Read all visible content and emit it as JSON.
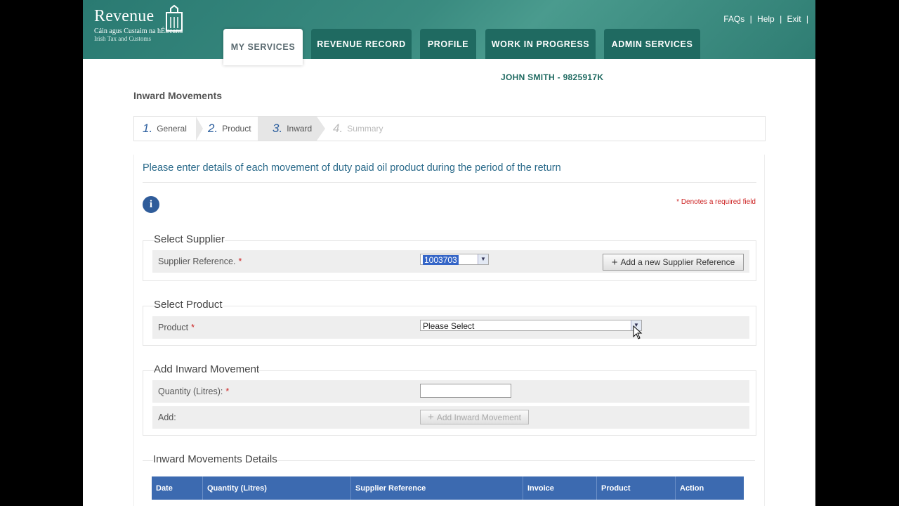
{
  "header": {
    "brand": "Revenue",
    "brand_sub_irish": "Cáin agus Custaim na hÉireann",
    "brand_sub_english": "Irish Tax and Customs",
    "links": [
      "FAQs",
      "Help",
      "Exit"
    ],
    "tabs": [
      "MY SERVICES",
      "REVENUE RECORD",
      "PROFILE",
      "WORK IN PROGRESS",
      "ADMIN SERVICES"
    ],
    "active_tab": "MY SERVICES"
  },
  "user": "JOHN SMITH - 9825917K",
  "page_title": "Inward Movements",
  "steps": [
    {
      "num": "1.",
      "label": "General"
    },
    {
      "num": "2.",
      "label": "Product"
    },
    {
      "num": "3.",
      "label": "Inward"
    },
    {
      "num": "4.",
      "label": "Summary"
    }
  ],
  "intro": "Please enter details of each movement of duty paid oil product during the period of the return",
  "required_note": "Denotes a required field",
  "supplier": {
    "legend": "Select Supplier",
    "label": "Supplier Reference.",
    "value": "1003703",
    "add_button": "Add a new Supplier Reference"
  },
  "product": {
    "legend": "Select Product",
    "label": "Product",
    "value": "Please Select"
  },
  "inward": {
    "legend": "Add Inward Movement",
    "quantity_label": "Quantity (Litres):",
    "quantity_value": "",
    "add_label": "Add:",
    "add_button": "Add Inward Movement"
  },
  "details": {
    "legend": "Inward Movements Details",
    "columns": [
      "Date",
      "Quantity (Litres)",
      "Supplier Reference",
      "Invoice",
      "Product",
      "Action"
    ]
  },
  "colors": {
    "header_bg": "#2a7a72",
    "table_header": "#3c6ab0",
    "required": "#cc2222"
  }
}
